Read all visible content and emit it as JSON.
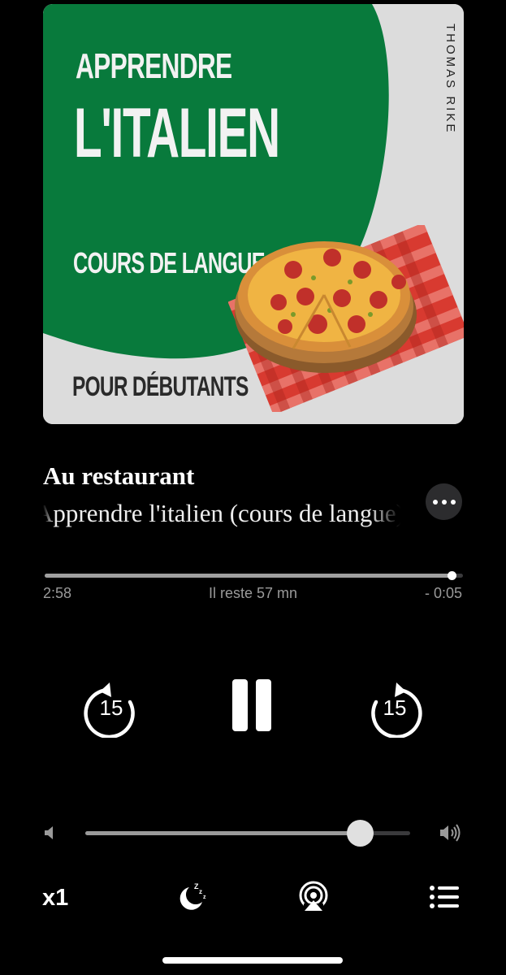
{
  "artwork": {
    "line1": "APPRENDRE",
    "line2": "L'ITALIEN",
    "line3": "COURS DE LANGUE",
    "line4": "POUR DÉBUTANTS",
    "author": "THOMAS RIKE",
    "colors": {
      "green": "#087a3c",
      "background": "#dcdcdc",
      "red": "#d83a30"
    }
  },
  "track": {
    "title": "Au restaurant",
    "subtitle": "Apprendre l'italien (cours de langue)",
    "more_icon": "ellipsis-icon"
  },
  "progress": {
    "elapsed": "2:58",
    "remaining_label": "Il reste 57 mn",
    "remaining": "- 0:05",
    "fraction": 0.973
  },
  "controls": {
    "skip_back_seconds": "15",
    "skip_forward_seconds": "15",
    "pause_icon": "pause-icon"
  },
  "volume": {
    "level": 0.845,
    "low_icon": "speaker-low-icon",
    "high_icon": "speaker-high-icon"
  },
  "bottom_bar": {
    "speed": "x1",
    "sleep_icon": "sleep-timer-icon",
    "airplay_icon": "airplay-icon",
    "queue_icon": "queue-list-icon"
  }
}
